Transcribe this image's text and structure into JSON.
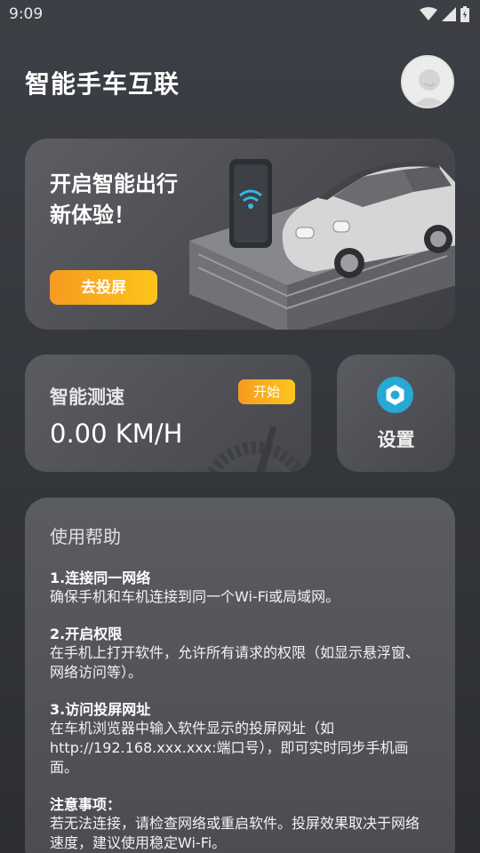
{
  "status_bar": {
    "time": "9:09"
  },
  "header": {
    "title": "智能手车互联"
  },
  "hero": {
    "title_line1": "开启智能出行",
    "title_line2": "新体验！",
    "button_label": "去投屏"
  },
  "speed": {
    "title": "智能测速",
    "value": "0.00 KM/H",
    "start_label": "开始"
  },
  "settings": {
    "label": "设置"
  },
  "help": {
    "title": "使用帮助",
    "sections": [
      {
        "heading": "1.连接同一网络",
        "body": "确保手机和车机连接到同一个Wi-Fi或局域网。"
      },
      {
        "heading": "2.开启权限",
        "body": "在手机上打开软件，允许所有请求的权限（如显示悬浮窗、网络访问等）。"
      },
      {
        "heading": "3.访问投屏网址",
        "body": "在车机浏览器中输入软件显示的投屏网址（如 http://192.168.xxx.xxx:端口号），即可实时同步手机画面。"
      },
      {
        "heading": "注意事项：",
        "body": "若无法连接，请检查网络或重启软件。投屏效果取决于网络速度，建议使用稳定Wi-Fi。"
      }
    ]
  },
  "colors": {
    "accent_gradient_start": "#f79a22",
    "accent_gradient_end": "#fcc61a",
    "settings_icon_bg": "#27a9d6",
    "background": "#3c3f45"
  }
}
